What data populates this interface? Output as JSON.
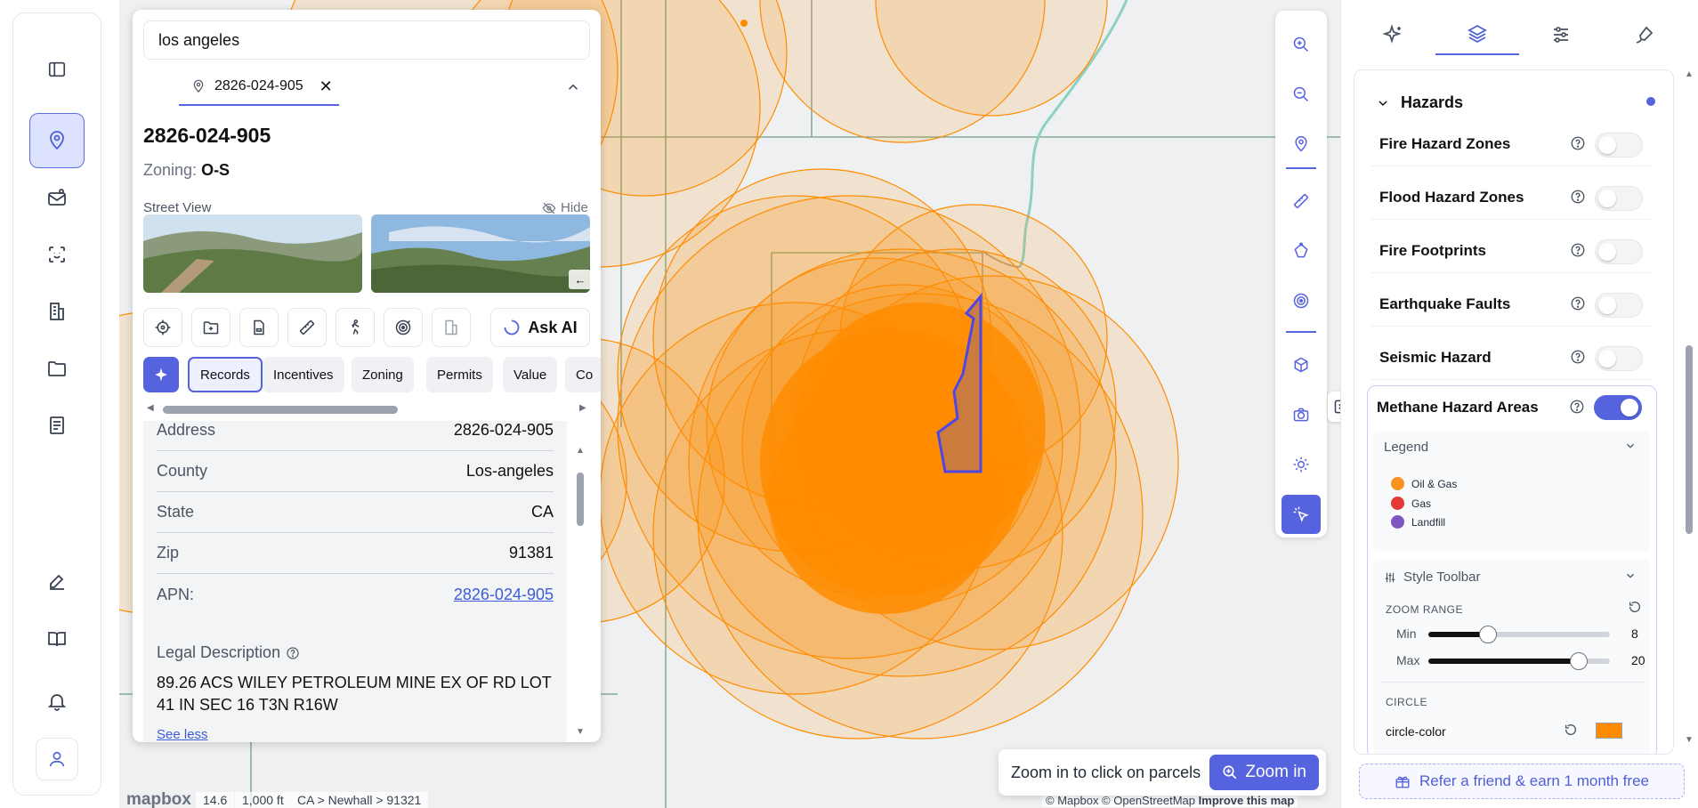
{
  "search": {
    "value": "los angeles"
  },
  "parcel": {
    "chip_label": "2826-024-905",
    "id": "2826-024-905",
    "zoning_label": "Zoning:",
    "zoning_value": "O-S",
    "street_view_label": "Street View",
    "hide_label": "Hide",
    "ask_ai_label": "Ask AI",
    "tabs": [
      "Records",
      "Incentives",
      "Zoning",
      "Permits",
      "Value",
      "Co"
    ],
    "records": [
      {
        "key": "Address",
        "value": "2826-024-905"
      },
      {
        "key": "County",
        "value": "Los-angeles"
      },
      {
        "key": "State",
        "value": "CA"
      },
      {
        "key": "Zip",
        "value": "91381"
      },
      {
        "key": "APN:",
        "value": "2826-024-905"
      }
    ],
    "legal_label": "Legal Description",
    "legal_text": "89.26 ACS WILEY PETROLEUM MINE EX OF RD LOT 41 IN SEC 16 T3N R16W",
    "see_less": "See less"
  },
  "map": {
    "logo": "mapbox",
    "zoom_level": "14.6",
    "scale": "1,000 ft",
    "breadcrumb": "CA > Newhall > 91321",
    "attribution_a": "© Mapbox © OpenStreetMap",
    "attribution_b": "Improve this map",
    "zoom_hint": "Zoom in to click on parcels",
    "zoom_in_button": "Zoom in",
    "circle_color": "#ff8c00",
    "parcel_outline": "#4f46e5"
  },
  "layers": {
    "section": "Hazards",
    "items": [
      {
        "label": "Fire Hazard Zones",
        "on": false
      },
      {
        "label": "Flood Hazard Zones",
        "on": false
      },
      {
        "label": "Fire Footprints",
        "on": false
      },
      {
        "label": "Earthquake Faults",
        "on": false
      },
      {
        "label": "Seismic Hazard",
        "on": false
      }
    ],
    "methane": {
      "label": "Methane Hazard Areas",
      "on": true,
      "legend_label": "Legend",
      "legend": [
        {
          "label": "Oil & Gas",
          "color": "#f7931e"
        },
        {
          "label": "Gas",
          "color": "#e53935"
        },
        {
          "label": "Landfill",
          "color": "#7e57c2"
        }
      ],
      "style_toolbar_label": "Style Toolbar",
      "zoom_range_label": "ZOOM RANGE",
      "min_label": "Min",
      "min_value": "8",
      "max_label": "Max",
      "max_value": "20",
      "min_fraction": 0.33,
      "max_fraction": 0.83,
      "circle_label": "CIRCLE",
      "circle_color_label": "circle-color",
      "circle_color_value": "#ff8c00"
    }
  },
  "referral": {
    "label": "Refer a friend & earn 1 month free"
  },
  "accent": "#5563de"
}
